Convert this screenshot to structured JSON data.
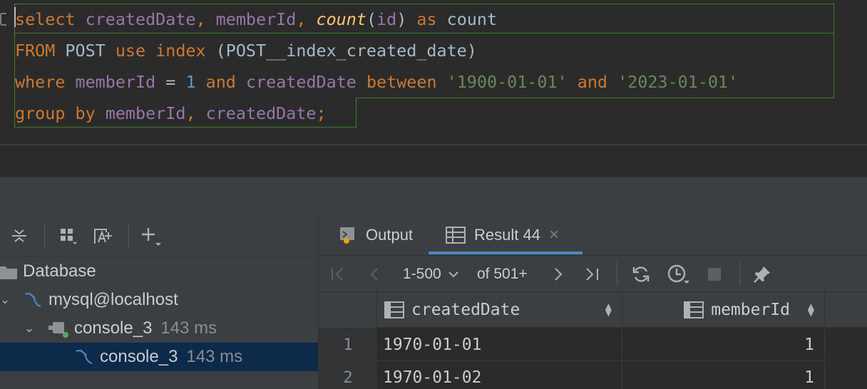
{
  "editor": {
    "line1": {
      "t1": "select",
      "t2": " ",
      "t3": "createdDate",
      "t4": ", ",
      "t5": "memberId",
      "t6": ", ",
      "t7": "count",
      "t8": "(",
      "t9": "id",
      "t10": ") ",
      "t11": "as",
      "t12": " count"
    },
    "line2": {
      "t1": "FROM",
      "t2": " POST ",
      "t3": "use index",
      "t4": " (POST__index_created_date)"
    },
    "line3": {
      "t1": "where",
      "t2": " ",
      "t3": "memberId",
      "t4": " = ",
      "t5": "1",
      "t6": " ",
      "t7": "and",
      "t8": " ",
      "t9": "createdDate",
      "t10": " ",
      "t11": "between",
      "t12": " ",
      "t13": "'1900-01-01'",
      "t14": " ",
      "t15": "and",
      "t16": " ",
      "t17": "'2023-01-01'"
    },
    "line4": {
      "t1": "group by",
      "t2": " ",
      "t3": "memberId",
      "t4": ", ",
      "t5": "createdDate",
      "t6": ";"
    }
  },
  "left_panel": {
    "tree": [
      {
        "label": "Database"
      },
      {
        "label": "mysql@localhost"
      },
      {
        "label": "console_3",
        "meta": "143 ms"
      },
      {
        "label": "console_3",
        "meta": "143 ms"
      }
    ]
  },
  "right_panel": {
    "tabs": [
      {
        "label": "Output"
      },
      {
        "label": "Result 44",
        "close": "×"
      }
    ],
    "nav": {
      "page_range": "1-500",
      "of_total": "of 501+"
    },
    "columns": [
      {
        "name": "createdDate"
      },
      {
        "name": "memberId"
      }
    ],
    "rows": [
      {
        "num": "1",
        "createdDate": "1970-01-01",
        "memberId": "1"
      },
      {
        "num": "2",
        "createdDate": "1970-01-02",
        "memberId": "1"
      }
    ]
  },
  "colors": {
    "keyword": "#cc7832",
    "identifier": "#9876aa",
    "function": "#ffc66d",
    "number": "#6897bb",
    "string": "#6a8759",
    "selection_border": "#3d7a2c",
    "tab_accent": "#4a88c7",
    "selected_row": "#0d2a4a"
  },
  "icons": [
    "collapse-icon",
    "layout-icon",
    "new-query-icon",
    "add-icon",
    "folder-icon",
    "mysql-icon",
    "console-icon",
    "output-icon",
    "table-icon",
    "first-page-icon",
    "prev-page-icon",
    "next-page-icon",
    "last-page-icon",
    "refresh-icon",
    "history-icon",
    "stop-icon",
    "pin-icon"
  ]
}
